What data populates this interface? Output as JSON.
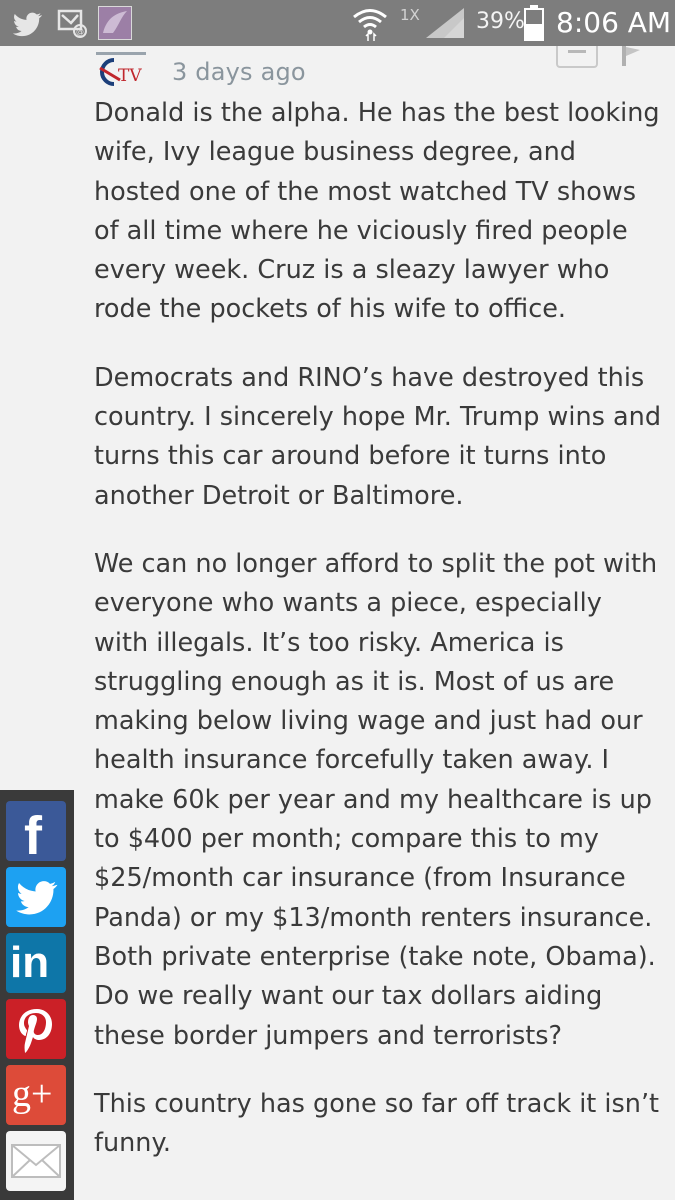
{
  "status_bar": {
    "roaming": "1X",
    "battery": "39%",
    "time": "8:06 AM",
    "icons": [
      "twitter-icon",
      "missed-call-icon",
      "app-thumbnail",
      "wifi-icon",
      "signal-icon",
      "battery-icon"
    ]
  },
  "comment": {
    "avatar_text": "TV",
    "timestamp": "3 days ago",
    "paragraphs": [
      "Donald is the alpha. He has the best looking wife, Ivy league business degree, and hosted one of the most watched TV shows of all time where he viciously fired people every week. Cruz is a sleazy lawyer who rode the pockets of his wife to office.",
      "Democrats and RINO’s have destroyed this country. I sincerely hope Mr. Trump wins and turns this car around before it turns into another Detroit or Baltimore.",
      "We can no longer afford to split the pot with everyone who wants a piece, especially with illegals. It’s too risky. America is struggling enough as it is. Most of us are making below living wage and just had our health insurance forcefully taken away. I make 60k per year and my healthcare is up to $400 per month; compare this to my $25/month car insurance (from Insurance Panda) or my $13/month renters insurance. Both private enterprise (take note, Obama). Do we really want our tax dollars aiding these border jumpers and terrorists?",
      "This country has gone so far off track it isn’t funny."
    ]
  },
  "share_rail": {
    "facebook_label": "f",
    "linkedin_label": "in",
    "google_label": "g+",
    "icons": [
      "facebook-icon",
      "twitter-icon",
      "linkedin-icon",
      "pinterest-icon",
      "google-plus-icon",
      "email-icon"
    ]
  },
  "colors": {
    "status_bar": "#7d7d7d",
    "background": "#f2f2f2",
    "text": "#3a3a3a",
    "timestamp": "#8a959d",
    "facebook": "#3b5998",
    "twitter": "#1da1f2",
    "linkedin": "#0e76a8",
    "pinterest": "#cb2027",
    "google": "#dd4b39"
  }
}
